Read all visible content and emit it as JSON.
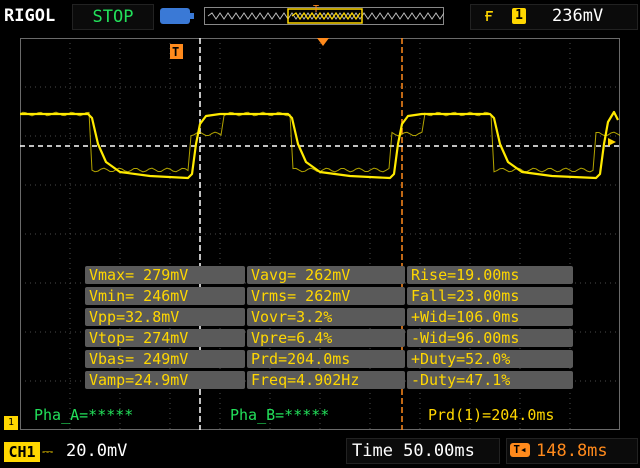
{
  "top_bar": {
    "brand": "RIGOL",
    "status": "STOP",
    "trigger": {
      "edge_icon": "rising-edge-icon",
      "source_badge": "1",
      "level": "236mV"
    },
    "overview_marker": "T"
  },
  "measurements": [
    [
      "Vmax= 279mV",
      "Vavg= 262mV",
      "Rise=19.00ms"
    ],
    [
      "Vmin= 246mV",
      "Vrms= 262mV",
      "Fall=23.00ms"
    ],
    [
      "Vpp=32.8mV",
      "Vovr=3.2%",
      "+Wid=106.0ms"
    ],
    [
      "Vtop= 274mV",
      "Vpre=6.4%",
      "-Wid=96.00ms"
    ],
    [
      "Vbas= 249mV",
      "Prd=204.0ms",
      "+Duty=52.0%"
    ],
    [
      "Vamp=24.9mV",
      "Freq=4.902Hz",
      "-Duty=47.1%"
    ]
  ],
  "phase": {
    "a": "Pha_A=*****",
    "b": "Pha_B=*****",
    "prd1": "Prd(1)=204.0ms"
  },
  "bottom_bar": {
    "channel": "CH1",
    "coupling_icon": "dc-coupling-icon",
    "scale": "20.0mV",
    "timebase": "Time 50.00ms",
    "delay_icon": "horizontal-position-icon",
    "delay": "148.8ms"
  },
  "markers": {
    "trigger_position": "T",
    "ground_marker": "1"
  },
  "colors": {
    "trace": "#ffea00",
    "accent": "#ffd700",
    "status_green": "#22e05a",
    "cursor_orange": "#ff8a1c",
    "panel_gray": "#5a5a5a"
  }
}
